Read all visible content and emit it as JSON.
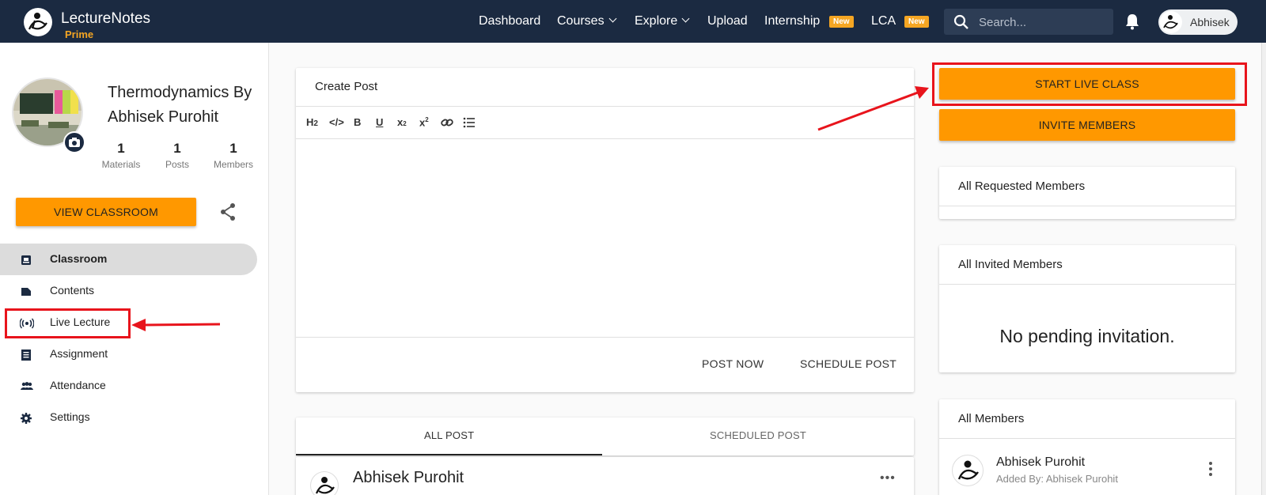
{
  "header": {
    "brand_name": "LectureNotes",
    "brand_tier": "Prime",
    "nav": {
      "dashboard": "Dashboard",
      "courses": "Courses",
      "explore": "Explore",
      "upload": "Upload",
      "internship": "Internship",
      "lca": "LCA",
      "new_badge": "New"
    },
    "search_placeholder": "Search...",
    "user_name": "Abhisek"
  },
  "sidebar": {
    "classroom_title": "Thermodynamics By Abhisek Purohit",
    "stats": {
      "materials_count": "1",
      "materials_label": "Materials",
      "posts_count": "1",
      "posts_label": "Posts",
      "members_count": "1",
      "members_label": "Members"
    },
    "view_classroom_label": "VIEW CLASSROOM",
    "menu": [
      {
        "label": "Classroom",
        "icon": "classroom-icon",
        "active": true
      },
      {
        "label": "Contents",
        "icon": "contents-icon",
        "active": false
      },
      {
        "label": "Live Lecture",
        "icon": "live-broadcast-icon",
        "active": false
      },
      {
        "label": "Assignment",
        "icon": "assignment-icon",
        "active": false
      },
      {
        "label": "Attendance",
        "icon": "attendance-icon",
        "active": false
      },
      {
        "label": "Settings",
        "icon": "settings-icon",
        "active": false
      }
    ]
  },
  "main": {
    "create_post_title": "Create Post",
    "toolbar_icons": [
      "heading-icon",
      "code-icon",
      "bold-icon",
      "underline-icon",
      "subscript-icon",
      "superscript-icon",
      "link-icon",
      "list-icon"
    ],
    "post_now_label": "POST NOW",
    "schedule_post_label": "SCHEDULE POST",
    "tabs": {
      "all_post": "ALL POST",
      "scheduled_post": "SCHEDULED POST"
    },
    "post_author": "Abhisek Purohit"
  },
  "right": {
    "start_live_class_label": "START LIVE CLASS",
    "invite_members_label": "INVITE MEMBERS",
    "requested_members_title": "All Requested Members",
    "invited_members_title": "All Invited Members",
    "no_pending_text": "No pending invitation.",
    "all_members_title": "All Members",
    "member_name": "Abhisek Purohit",
    "member_added_by": "Added By: Abhisek Purohit"
  },
  "colors": {
    "header_bg": "#1b2a41",
    "accent_orange": "#ff9800",
    "badge_yellow": "#f5a623",
    "highlight_red": "#e8141c"
  }
}
